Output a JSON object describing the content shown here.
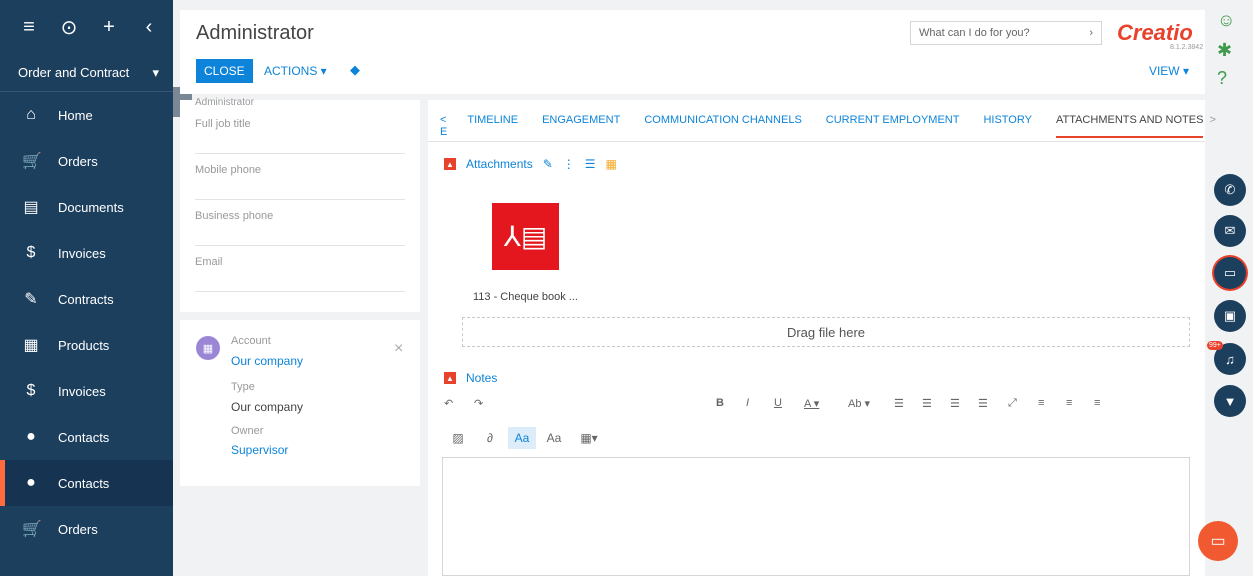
{
  "sidebar": {
    "top_icons": [
      "menu-icon",
      "play-icon",
      "plus-icon",
      "chevron-left-icon"
    ],
    "workspace": "Order and Contract",
    "items": [
      {
        "label": "Home",
        "icon": "home-icon",
        "glyph": "⌂"
      },
      {
        "label": "Orders",
        "icon": "cart-icon",
        "glyph": "🛒"
      },
      {
        "label": "Documents",
        "icon": "document-icon",
        "glyph": "▤"
      },
      {
        "label": "Invoices",
        "icon": "invoice-icon",
        "glyph": "$"
      },
      {
        "label": "Contracts",
        "icon": "contract-icon",
        "glyph": "✎"
      },
      {
        "label": "Products",
        "icon": "products-icon",
        "glyph": "▦"
      },
      {
        "label": "Invoices",
        "icon": "invoice-icon",
        "glyph": "$"
      },
      {
        "label": "Contacts",
        "icon": "contact-icon",
        "glyph": "●"
      },
      {
        "label": "Contacts",
        "icon": "contact-icon",
        "glyph": "●",
        "active": true
      },
      {
        "label": "Orders",
        "icon": "cart-icon",
        "glyph": "🛒"
      }
    ]
  },
  "header": {
    "title": "Administrator",
    "close_label": "CLOSE",
    "actions_label": "ACTIONS ▾",
    "search_placeholder": "What can I do for you?",
    "logo": "Creatio",
    "version": "8.1.2.3842",
    "view_label": "VIEW ▾"
  },
  "profile": {
    "cut_label": "Administrator",
    "fields": [
      "Full job title",
      "Mobile phone",
      "Business phone",
      "Email"
    ]
  },
  "account": {
    "account_label": "Account",
    "account_value": "Our company",
    "type_label": "Type",
    "type_value": "Our company",
    "owner_label": "Owner",
    "owner_value": "Supervisor"
  },
  "tabs": {
    "prev": "< E",
    "items": [
      "TIMELINE",
      "ENGAGEMENT",
      "COMMUNICATION CHANNELS",
      "CURRENT EMPLOYMENT",
      "HISTORY",
      "ATTACHMENTS AND NOTES"
    ],
    "active": "ATTACHMENTS AND NOTES",
    "next": ">"
  },
  "attachments": {
    "title": "Attachments",
    "file_name": "113 - Cheque book ...",
    "dropzone": "Drag file here"
  },
  "notes": {
    "title": "Notes",
    "toolbar_fmt": [
      "B",
      "I",
      "U"
    ],
    "font_btn_1": "Aa",
    "font_btn_2": "Aa"
  },
  "rail": {
    "notification_count": "99+"
  },
  "colors": {
    "brand": "#e8412c",
    "sidebar": "#1d3f5e",
    "link": "#0d84d9"
  }
}
